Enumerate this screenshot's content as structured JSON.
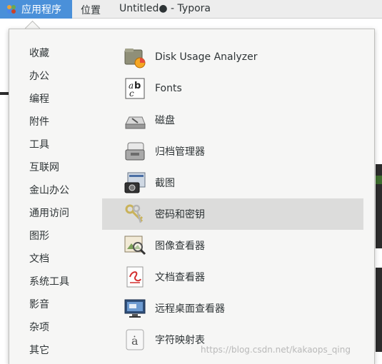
{
  "topbar": {
    "apps_menu_label": "应用程序",
    "places_label": "位置",
    "window_title": "Untitled● - Typora"
  },
  "menu": {
    "categories": [
      {
        "label": "收藏"
      },
      {
        "label": "办公"
      },
      {
        "label": "编程"
      },
      {
        "label": "附件"
      },
      {
        "label": "工具"
      },
      {
        "label": "互联网"
      },
      {
        "label": "金山办公"
      },
      {
        "label": "通用访问"
      },
      {
        "label": "图形"
      },
      {
        "label": "文档"
      },
      {
        "label": "系统工具"
      },
      {
        "label": "影音"
      },
      {
        "label": "杂项"
      },
      {
        "label": "其它"
      }
    ],
    "apps": [
      {
        "label": "Disk Usage Analyzer",
        "icon": "disk-usage-icon"
      },
      {
        "label": "Fonts",
        "icon": "fonts-icon"
      },
      {
        "label": "磁盘",
        "icon": "disks-icon"
      },
      {
        "label": "归档管理器",
        "icon": "archive-manager-icon"
      },
      {
        "label": "截图",
        "icon": "screenshot-icon"
      },
      {
        "label": "密码和密钥",
        "icon": "passwords-keys-icon",
        "highlighted": true
      },
      {
        "label": "图像查看器",
        "icon": "image-viewer-icon"
      },
      {
        "label": "文档查看器",
        "icon": "document-viewer-icon"
      },
      {
        "label": "远程桌面查看器",
        "icon": "remote-desktop-icon"
      },
      {
        "label": "字符映射表",
        "icon": "character-map-icon"
      }
    ]
  },
  "watermark": "https://blog.csdn.net/kakaops_qing",
  "colors": {
    "accent": "#4a90d9",
    "highlight": "#dcdcdb",
    "menu_bg": "#f6f6f5"
  }
}
